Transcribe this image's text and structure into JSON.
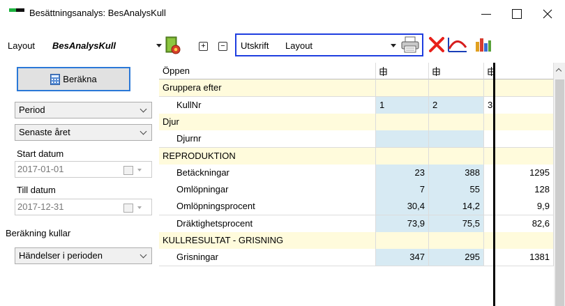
{
  "window": {
    "title": "Besättningsanalys: BesAnalysKull",
    "colors": {
      "accent": "#1e3ee0",
      "section_bg": "#fffbdc",
      "value_bg": "#d7eaf3"
    }
  },
  "toolbar": {
    "layout_label": "Layout",
    "layout_value": "BesAnalysKull",
    "expand_symbol": "+",
    "collapse_symbol": "−",
    "utskrift_label": "Utskrift",
    "utskrift_value": "Layout",
    "icons": [
      "book-settings-icon",
      "printer-icon",
      "delete-icon",
      "chart-curve-icon",
      "bar-chart-icon"
    ]
  },
  "left_panel": {
    "calculate_button": "Beräkna",
    "period_select": "Period",
    "range_select": "Senaste året",
    "start_label": "Start datum",
    "start_value": "2017-01-01",
    "end_label": "Till datum",
    "end_value": "2017-12-31",
    "calc_label": "Beräkning kullar",
    "calc_select": "Händelser i perioden"
  },
  "grid": {
    "header_label": "Öppen",
    "rows": [
      {
        "label": "Gruppera efter",
        "type": "section",
        "values": [
          "",
          "",
          "",
          ""
        ]
      },
      {
        "label": "KullNr",
        "type": "item",
        "values": [
          "1",
          "2",
          "3",
          ""
        ],
        "align": "left"
      },
      {
        "label": "Djur",
        "type": "section",
        "values": [
          "",
          "",
          "",
          ""
        ]
      },
      {
        "label": "Djurnr",
        "type": "item",
        "values": [
          "",
          "",
          "",
          ""
        ]
      },
      {
        "label": "REPRODUKTION",
        "type": "section",
        "values": [
          "",
          "",
          "",
          ""
        ]
      },
      {
        "label": "Betäckningar",
        "type": "item",
        "values": [
          "23",
          "388",
          "",
          "1295"
        ]
      },
      {
        "label": "Omlöpningar",
        "type": "item",
        "values": [
          "7",
          "55",
          "",
          "128"
        ]
      },
      {
        "label": "Omlöpningsprocent",
        "type": "item",
        "values": [
          "30,4",
          "14,2",
          "",
          "9,9"
        ]
      },
      {
        "label": "Dräktighetsprocent",
        "type": "item",
        "values": [
          "73,9",
          "75,5",
          "",
          "82,6"
        ]
      },
      {
        "label": "KULLRESULTAT - GRISNING",
        "type": "section",
        "values": [
          "",
          "",
          "",
          ""
        ]
      },
      {
        "label": "Grisningar",
        "type": "item",
        "values": [
          "347",
          "295",
          "",
          "1381"
        ]
      }
    ]
  }
}
